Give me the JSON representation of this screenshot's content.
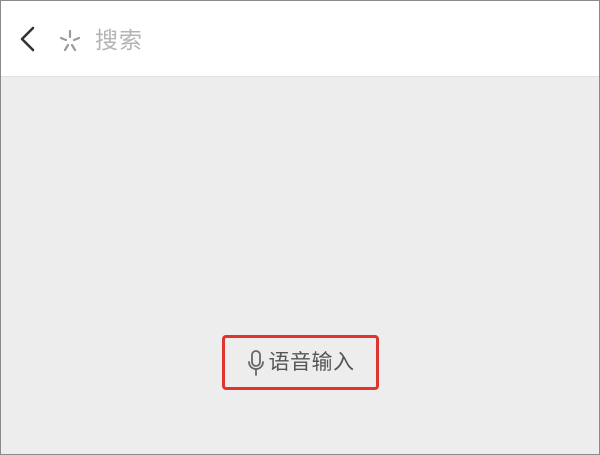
{
  "header": {
    "back_icon": "chevron-left-icon",
    "search_icon": "sparkle-icon",
    "search_placeholder": "搜索"
  },
  "main": {
    "voice_input": {
      "icon": "microphone-icon",
      "label": "语音输入",
      "highlight_color": "#e0352e"
    }
  },
  "colors": {
    "header_bg": "#ffffff",
    "content_bg": "#ededed",
    "placeholder_text": "#b4b4b4",
    "label_text": "#555555"
  }
}
